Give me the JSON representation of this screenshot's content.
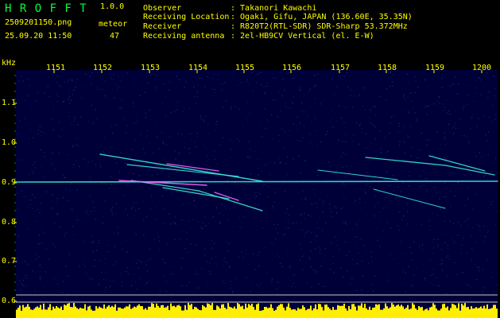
{
  "app": {
    "name": "H R O F F T",
    "version": "1.0.0"
  },
  "file": {
    "name": "2509201150.png",
    "datetime": "25.09.20 11:50"
  },
  "counter": {
    "label": "meteor",
    "value": "47"
  },
  "station": [
    {
      "key": "Observer",
      "value": ": Takanori Kawachi"
    },
    {
      "key": "Receiving Location",
      "value": ": Ogaki, Gifu, JAPAN (136.60E, 35.35N)"
    },
    {
      "key": "Receiver",
      "value": ": R820T2(RTL-SDR) SDR-Sharp 53.372MHz"
    },
    {
      "key": "Receiving antenna",
      "value": ": 2el-HB9CV Vertical (el. E-W)"
    }
  ],
  "spectrogram": {
    "y_unit": "kHz",
    "y_ticks": [
      "1.1",
      "1.0",
      "0.9",
      "0.8",
      "0.7",
      "0.6"
    ],
    "x_ticks": [
      "1151",
      "1152",
      "1153",
      "1154",
      "1155",
      "1156",
      "1157",
      "1158",
      "1159",
      "1200"
    ],
    "colors": {
      "background": "#000038",
      "noise": "#2438a8",
      "trail": "#38e8d8",
      "trail_hot": "#ff60ff",
      "level": "#ffee00",
      "level_base": "#00c8ff",
      "labels": "#ffff00"
    }
  }
}
